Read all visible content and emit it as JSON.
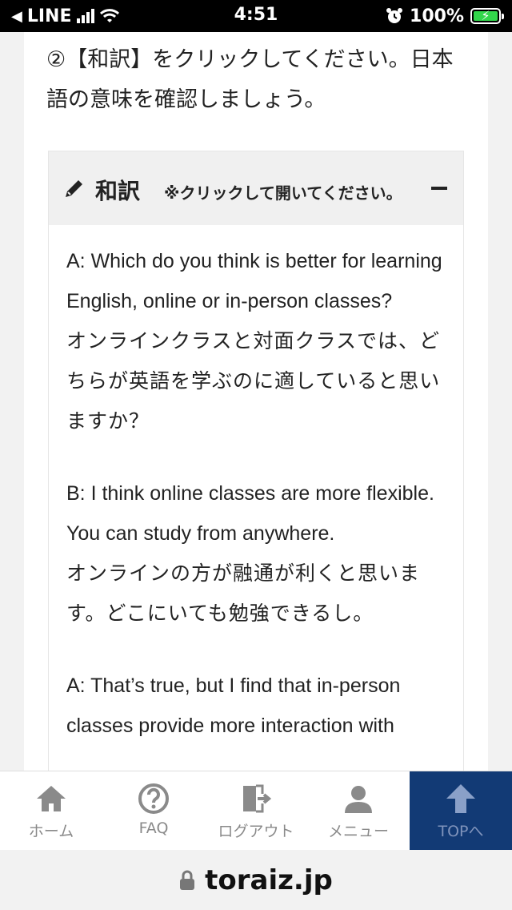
{
  "status_bar": {
    "back_app": "LINE",
    "time": "4:51",
    "battery": "100%"
  },
  "instruction": {
    "text": "②【和訳】をクリックしてください。日本語の意味を確認しましょう。"
  },
  "accordion": {
    "title": "和訳",
    "note": "※クリックして開いてください。",
    "paragraphs": [
      {
        "en": "A: Which do you think is better for learning English, online or in-person classes?",
        "ja": "オンラインクラスと対面クラスでは、どちらが英語を学ぶのに適していると思いますか？"
      },
      {
        "en": "B: I think online classes are more flexible. You can study from anywhere.",
        "ja": "オンラインの方が融通が利くと思います。どこにいても勉強できるし。"
      },
      {
        "en": "A: That’s true, but I find that in-person classes provide more interaction with"
      }
    ]
  },
  "bottom_nav": {
    "items": [
      {
        "label": "ホーム",
        "icon": "home-icon"
      },
      {
        "label": "FAQ",
        "icon": "question-circle-icon"
      },
      {
        "label": "ログアウト",
        "icon": "logout-door-icon"
      },
      {
        "label": "メニュー",
        "icon": "user-icon"
      },
      {
        "label": "TOPへ",
        "icon": "arrow-up-icon"
      }
    ]
  },
  "browser": {
    "url": "toraiz.jp"
  },
  "colors": {
    "nav_top_bg": "#123a75",
    "battery_green": "#32d74b",
    "accordion_header_bg": "#f0f0f0"
  }
}
